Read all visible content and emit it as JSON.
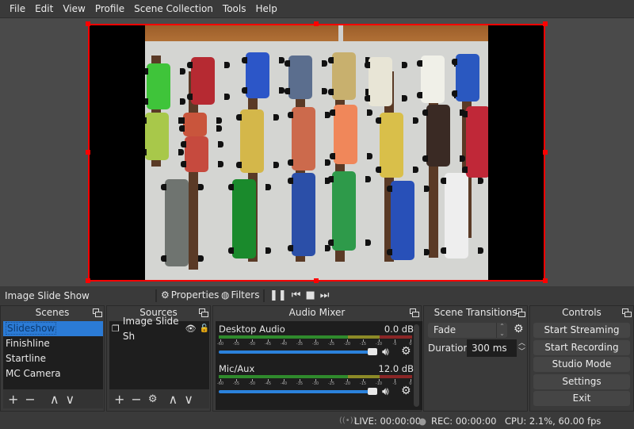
{
  "menubar": {
    "items": [
      "File",
      "Edit",
      "View",
      "Profile",
      "Scene Collection",
      "Tools",
      "Help"
    ]
  },
  "preview": {
    "selection_color": "#ff0000",
    "content_description": "Photo of pinewood derby cars lined up on a table"
  },
  "source_toolbar": {
    "selected_source": "Image Slide Show",
    "properties_label": "Properties",
    "filters_label": "Filters",
    "media_controls": [
      "pause",
      "previous",
      "stop",
      "next"
    ]
  },
  "scenes": {
    "title": "Scenes",
    "items": [
      {
        "label": "Slideshow",
        "selected": true
      },
      {
        "label": "Finishline",
        "selected": false
      },
      {
        "label": "Startline",
        "selected": false
      },
      {
        "label": "MC Camera",
        "selected": false
      }
    ]
  },
  "sources": {
    "title": "Sources",
    "items": [
      {
        "label": "Image Slide Sh",
        "visible": true,
        "locked": false
      }
    ]
  },
  "audio_mixer": {
    "title": "Audio Mixer",
    "meter_ticks": [
      "-60",
      "-55",
      "-50",
      "-45",
      "-40",
      "-35",
      "-30",
      "-25",
      "-20",
      "-15",
      "-10",
      "-5",
      "0"
    ],
    "channels": [
      {
        "name": "Desktop Audio",
        "level": "0.0 dB",
        "volume_fraction": 1.0
      },
      {
        "name": "Mic/Aux",
        "level": "12.0 dB",
        "volume_fraction": 1.0
      }
    ],
    "colors": {
      "green": "#2f8a2c",
      "yellow": "#8c8a27",
      "red": "#8a2727",
      "slider": "#2b82dc"
    }
  },
  "transitions": {
    "title": "Scene Transitions",
    "selected": "Fade",
    "duration_label": "Duration",
    "duration_value": "300 ms"
  },
  "controls": {
    "title": "Controls",
    "buttons": [
      "Start Streaming",
      "Start Recording",
      "Studio Mode",
      "Settings",
      "Exit"
    ]
  },
  "status": {
    "live": "LIVE: 00:00:00",
    "rec": "REC: 00:00:00",
    "cpu": "CPU: 2.1%, 60.00 fps"
  }
}
